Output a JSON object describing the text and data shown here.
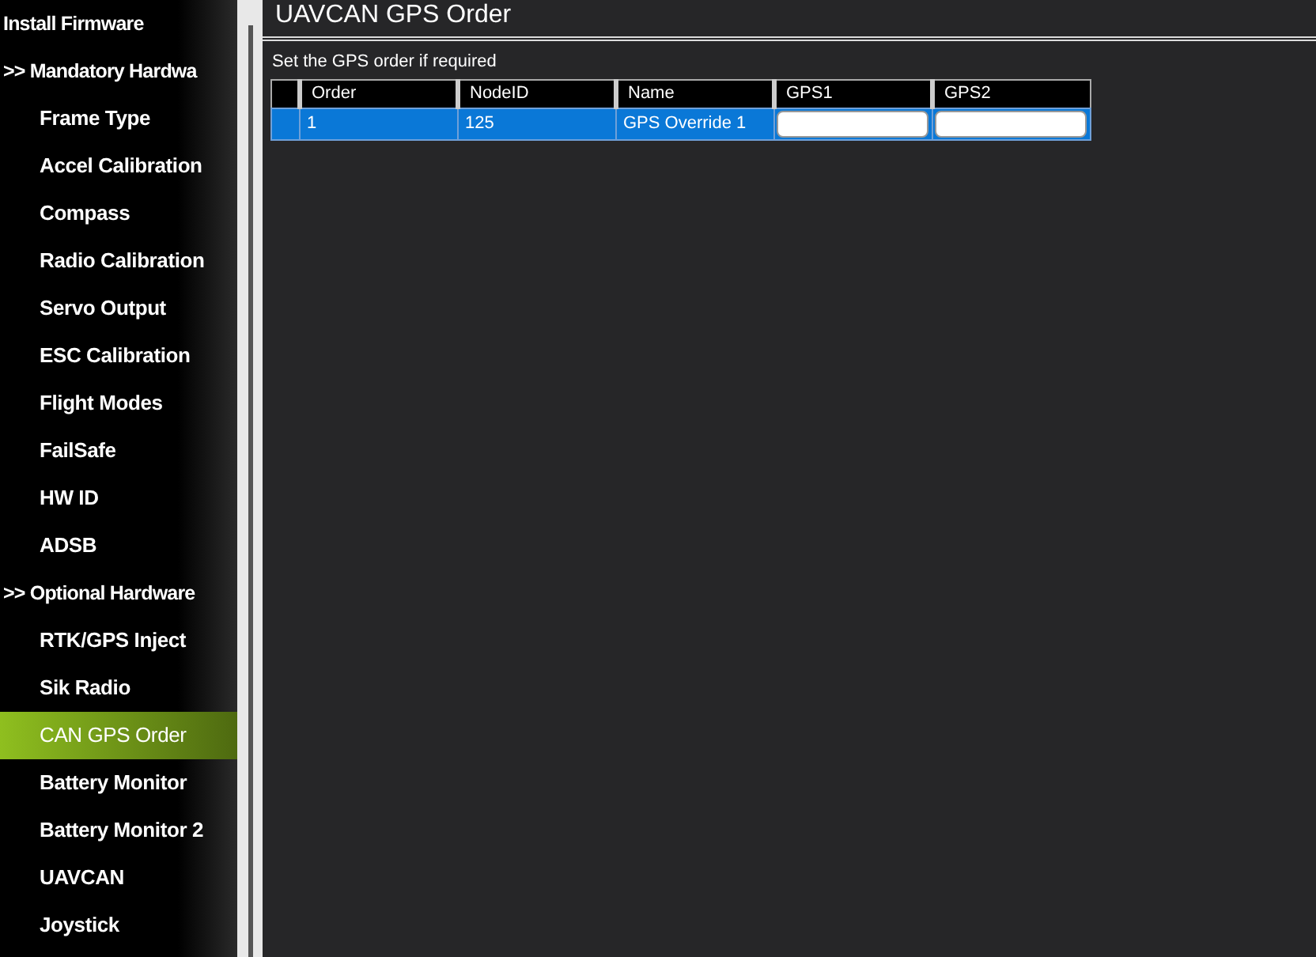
{
  "sidebar": {
    "items": [
      {
        "label": "Install Firmware",
        "kind": "top",
        "selected": false
      },
      {
        "label": ">> Mandatory Hardwa",
        "kind": "top",
        "selected": false
      },
      {
        "label": "Frame Type",
        "kind": "sub",
        "selected": false
      },
      {
        "label": "Accel Calibration",
        "kind": "sub",
        "selected": false
      },
      {
        "label": "Compass",
        "kind": "sub",
        "selected": false
      },
      {
        "label": "Radio Calibration",
        "kind": "sub",
        "selected": false
      },
      {
        "label": "Servo Output",
        "kind": "sub",
        "selected": false
      },
      {
        "label": "ESC Calibration",
        "kind": "sub",
        "selected": false
      },
      {
        "label": "Flight Modes",
        "kind": "sub",
        "selected": false
      },
      {
        "label": "FailSafe",
        "kind": "sub",
        "selected": false
      },
      {
        "label": "HW ID",
        "kind": "sub",
        "selected": false
      },
      {
        "label": "ADSB",
        "kind": "sub",
        "selected": false
      },
      {
        "label": ">> Optional Hardware",
        "kind": "top",
        "selected": false
      },
      {
        "label": "RTK/GPS Inject",
        "kind": "sub",
        "selected": false
      },
      {
        "label": "Sik Radio",
        "kind": "sub",
        "selected": false
      },
      {
        "label": "CAN GPS Order",
        "kind": "sub",
        "selected": true
      },
      {
        "label": "Battery Monitor",
        "kind": "sub",
        "selected": false
      },
      {
        "label": "Battery Monitor 2",
        "kind": "sub",
        "selected": false
      },
      {
        "label": "UAVCAN",
        "kind": "sub",
        "selected": false
      },
      {
        "label": "Joystick",
        "kind": "sub",
        "selected": false
      }
    ]
  },
  "panel": {
    "title": "UAVCAN GPS Order",
    "hint": "Set the GPS order if required"
  },
  "table": {
    "columns": [
      "Order",
      "NodeID",
      "Name",
      "GPS1",
      "GPS2"
    ],
    "rows": [
      {
        "selected": true,
        "cells": [
          "1",
          "125",
          "GPS Override 1"
        ],
        "inputs": [
          {
            "kind": "field"
          },
          {
            "kind": "field"
          }
        ]
      }
    ]
  }
}
